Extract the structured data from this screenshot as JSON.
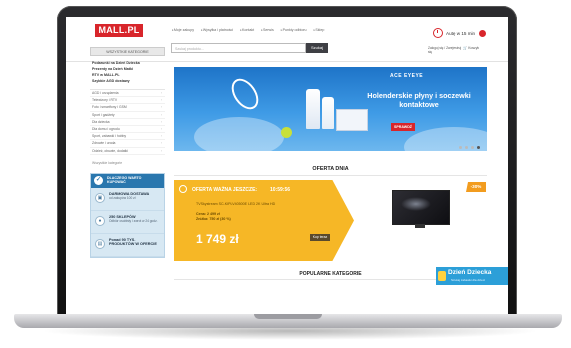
{
  "header": {
    "logo": "MALL.PL",
    "nav": [
      "Moje zakupy",
      "Wysyłka i płatności",
      "Kontakt",
      "Serwis",
      "Punkty odbioru",
      "Sklep"
    ],
    "search_placeholder": "Szukaj produktu...",
    "search_button": "Szukaj",
    "delivery": "Autę w 15 min",
    "account": "Zaloguj się / Zarejestruj się",
    "cart": "Koszyk"
  },
  "sidebar": {
    "all_categories_button": "WSZYSTKIE KATEGORIE",
    "promo_links": [
      "Podarunki na Dzień Dziecka",
      "Prezenty na Dzień Matki",
      "RTV w MALL.PL",
      "Szybkie AGD dostawy"
    ],
    "categories": [
      "AGD i urządzenia",
      "Telewizory i RTV",
      "Foto i smartfony i GSM",
      "Sport i gadżety",
      "Dla dziecka",
      "Dla domu i ogrodu",
      "Sport, zabawki i hobby",
      "Zdrowie i uroda",
      "Odzież, obuwie, dodatki"
    ],
    "all_link": "Wszystkie kategorie",
    "info": {
      "header": "DLACZEGO WARTO KUPOWAĆ",
      "items": [
        {
          "title": "DARMOWA DOSTAWA",
          "sub": "od zakupów 100 zł"
        },
        {
          "title": "250 SKLEPÓW",
          "sub": "Odbiór osobisty i zwrot w 24 godz."
        },
        {
          "title": "Ponad 90 TYS. PRODUKTÓW W OFERCIE",
          "sub": ""
        }
      ]
    }
  },
  "banner": {
    "brand": "ACE EYEYE",
    "title": "Holenderskie płyny i soczewki kontaktowe",
    "button": "SPRAWDŹ",
    "dots_count": 4
  },
  "deal": {
    "section_title": "OFERTA DNIA",
    "title": "OFERTA WAŻNA JESZCZE:",
    "timer": "10:59:56",
    "description": "TVSkystream SC-KIPLV40500E LED 2K Ultra HD",
    "old_price_line1": "Cena: 2 499 zł",
    "old_price_line2": "Zniżka: 750 zł (30 %)",
    "price": "1 749 zł",
    "button": "Kup teraz",
    "discount_badge": "-30%"
  },
  "popular": {
    "title": "POPULARNE KATEGORIE"
  },
  "side_banner": {
    "title": "Dzień Dziecka",
    "subtitle": "Szukaj zabawki dla dzieci"
  },
  "colors": {
    "brand_red": "#d8252b",
    "deal_yellow": "#f6b726",
    "info_blue": "#2a77ae",
    "banner_blue": "#1e74c8"
  }
}
